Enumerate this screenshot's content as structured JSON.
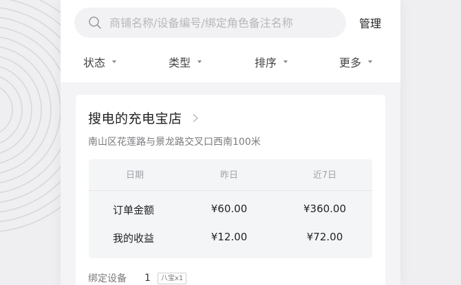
{
  "search": {
    "placeholder": "商铺名称/设备编号/绑定角色备注名称",
    "value": ""
  },
  "header": {
    "manage_label": "管理"
  },
  "filters": [
    {
      "label": "状态"
    },
    {
      "label": "类型"
    },
    {
      "label": "排序"
    },
    {
      "label": "更多"
    }
  ],
  "store": {
    "name": "搜电的充电宝店",
    "address": "南山区花莲路与景龙路交叉口西南100米",
    "stats": {
      "headers": [
        "日期",
        "昨日",
        "近7日"
      ],
      "rows": [
        {
          "label": "订单金额",
          "yesterday": "¥60.00",
          "last7": "¥360.00"
        },
        {
          "label": "我的收益",
          "yesterday": "¥12.00",
          "last7": "¥72.00"
        }
      ]
    },
    "bound": {
      "label": "绑定设备",
      "count": "1",
      "tag": "八宝x1"
    }
  }
}
